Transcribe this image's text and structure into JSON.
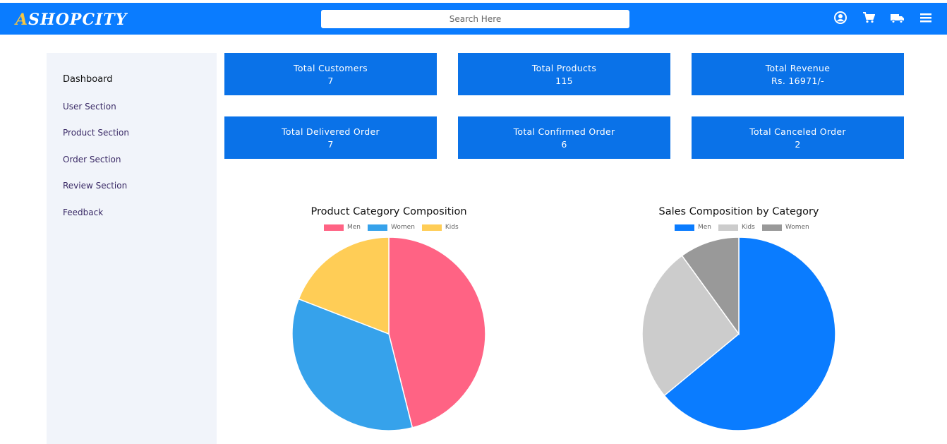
{
  "header": {
    "logo_first": "A",
    "logo_rest": "SHOPCITY",
    "search_placeholder": "Search Here",
    "icons": [
      "account-icon",
      "cart-icon",
      "delivery-truck-icon",
      "menu-icon"
    ]
  },
  "sidebar": {
    "items": [
      {
        "label": "Dashboard",
        "active": true
      },
      {
        "label": "User Section"
      },
      {
        "label": "Product Section"
      },
      {
        "label": "Order Section"
      },
      {
        "label": "Review Section"
      },
      {
        "label": "Feedback"
      }
    ]
  },
  "stats": [
    {
      "label": "Total Customers",
      "value": "7"
    },
    {
      "label": "Total Products",
      "value": "115"
    },
    {
      "label": "Total Revenue",
      "value": "Rs. 16971/-"
    },
    {
      "label": "Total Delivered Order",
      "value": "7"
    },
    {
      "label": "Total Confirmed Order",
      "value": "6"
    },
    {
      "label": "Total Canceled Order",
      "value": "2"
    }
  ],
  "colors": {
    "brand": "#0a7cff",
    "card": "#0a72e8",
    "sidebar_bg": "#f1f4fa"
  },
  "chart_data": [
    {
      "type": "pie",
      "title": "Product Category Composition",
      "legend_position": "top",
      "categories": [
        "Men",
        "Women",
        "Kids"
      ],
      "values": [
        53,
        40,
        22
      ],
      "colors": [
        "#ff6384",
        "#36a2eb",
        "#ffcd56"
      ]
    },
    {
      "type": "pie",
      "title": "Sales Composition by Category",
      "legend_position": "top",
      "categories": [
        "Men",
        "Kids",
        "Women"
      ],
      "values": [
        64,
        26,
        10
      ],
      "colors": [
        "#0a7cff",
        "#cccccc",
        "#999999"
      ]
    }
  ]
}
